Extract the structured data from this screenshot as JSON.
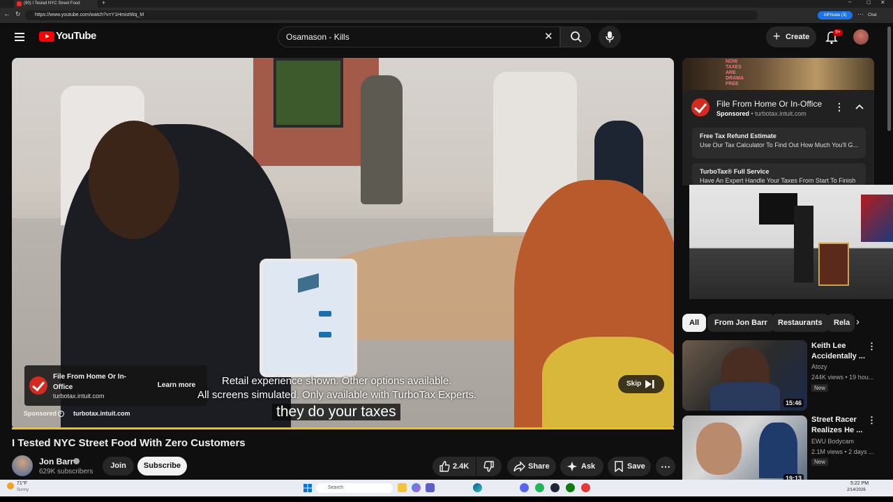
{
  "browser": {
    "tab_title": "(90) I Tested NYC Street Food",
    "url": "https://www.youtube.com/watch?v=Y1HmistWq_M",
    "inprivate_label": "InPrivate (3)",
    "chat_label": "Chat"
  },
  "header": {
    "logo_text": "YouTube",
    "search_value": "Osamason - Kills",
    "create_label": "Create",
    "notification_badge": "9+"
  },
  "ad_overlay": {
    "title": "File From Home Or In-Office",
    "domain": "turbotax.intuit.com",
    "learn_more": "Learn more",
    "sponsored": "Sponsored",
    "sponsored_domain": "turbotax.intuit.com",
    "skip": "Skip"
  },
  "captions": {
    "line1": "Retail experience shown. Other options available.",
    "line2": "All screens simulated. Only available with TurboTax Experts.",
    "line3": "they do your taxes"
  },
  "video": {
    "title": "I Tested NYC Street Food With Zero Customers",
    "channel": "Jon Barr",
    "subscribers": "629K subscribers",
    "join": "Join",
    "subscribe": "Subscribe",
    "likes": "2.4K",
    "share": "Share",
    "ask": "Ask",
    "save": "Save"
  },
  "sidebar_ad": {
    "banner_text": "NOW TAXES ARE DRAMA FREE",
    "title": "File From Home Or In-Office",
    "sponsored": "Sponsored",
    "domain": "turbotax.intuit.com",
    "links": [
      {
        "title": "Free Tax Refund Estimate",
        "desc": "Use Our Tax Calculator To Find Out How Much You'll G..."
      },
      {
        "title": "TurboTax® Full Service",
        "desc": "Have An Expert Handle Your Taxes From Start To Finish"
      }
    ]
  },
  "chips": [
    "All",
    "From Jon Barr",
    "Restaurants",
    "Rela"
  ],
  "recommendations": [
    {
      "title": "Keith Lee Accidentally ...",
      "channel": "Atozy",
      "views": "244K views • 19 hou...",
      "badge": "New",
      "duration": "15:46"
    },
    {
      "title": "Street Racer Realizes He ...",
      "channel": "EWU Bodycam",
      "views": "2.1M views • 2 days ...",
      "badge": "New",
      "duration": "19:13"
    }
  ],
  "taskbar": {
    "temp": "71°F",
    "weather": "Sunny",
    "search_placeholder": "Search",
    "time": "5:22 PM",
    "date": "2/14/2026"
  }
}
